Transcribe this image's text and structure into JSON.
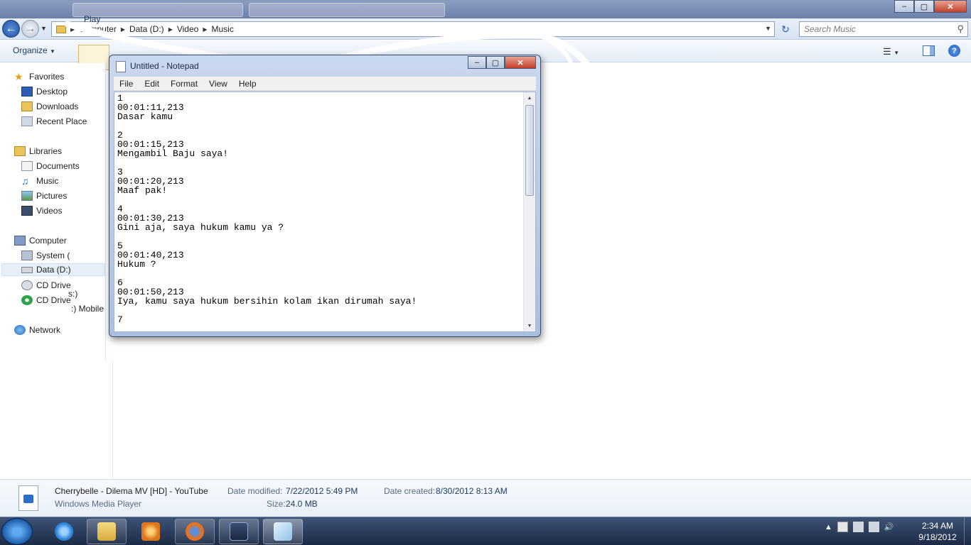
{
  "explorer": {
    "breadcrumb": [
      "Computer",
      "Data (D:)",
      "Video",
      "Music"
    ],
    "search_placeholder": "Search Music",
    "organize_label": "Organize",
    "play_label": "Play"
  },
  "navpane": {
    "favorites_label": "Favorites",
    "favorites": [
      "Desktop",
      "Downloads",
      "Recent Place"
    ],
    "libraries_label": "Libraries",
    "libraries": [
      "Documents",
      "Music",
      "Pictures",
      "Videos"
    ],
    "computer_label": "Computer",
    "drives": [
      "System (",
      "Data (D:)",
      "CD Drive",
      "CD Drive"
    ],
    "drive_fragments": [
      "s:)",
      ":) Mobile"
    ],
    "network_label": "Network"
  },
  "notepad": {
    "title": "Untitled - Notepad",
    "menu": [
      "File",
      "Edit",
      "Format",
      "View",
      "Help"
    ],
    "content": "1\n00:01:11,213\nDasar kamu\n\n2\n00:01:15,213\nMengambil Baju saya!\n\n3\n00:01:20,213\nMaaf pak!\n\n4\n00:01:30,213\nGini aja, saya hukum kamu ya ?\n\n5\n00:01:40,213\nHukum ?\n\n6\n00:01:50,213\nIya, kamu saya hukum bersihin kolam ikan dirumah saya!\n\n7",
    "scroll_fraction": 0.0
  },
  "details": {
    "file_name": "Cherrybelle - Dilema MV [HD] - YouTube",
    "file_type": "Windows Media Player",
    "date_modified_label": "Date modified:",
    "date_modified": "7/22/2012 5:49 PM",
    "date_created_label": "Date created:",
    "date_created": "8/30/2012 8:13 AM",
    "size_label": "Size:",
    "size": "24.0 MB"
  },
  "taskbar": {
    "time": "2:34 AM",
    "date": "9/18/2012",
    "pinned": [
      "internet-explorer-icon",
      "explorer-folder-icon",
      "media-player-icon",
      "firefox-icon",
      "kmplayer-icon",
      "notepad-icon"
    ]
  },
  "colors": {
    "accent": "#1e395b",
    "taskbar": "#1c2a45",
    "window_frame": "#a9bfe0"
  }
}
